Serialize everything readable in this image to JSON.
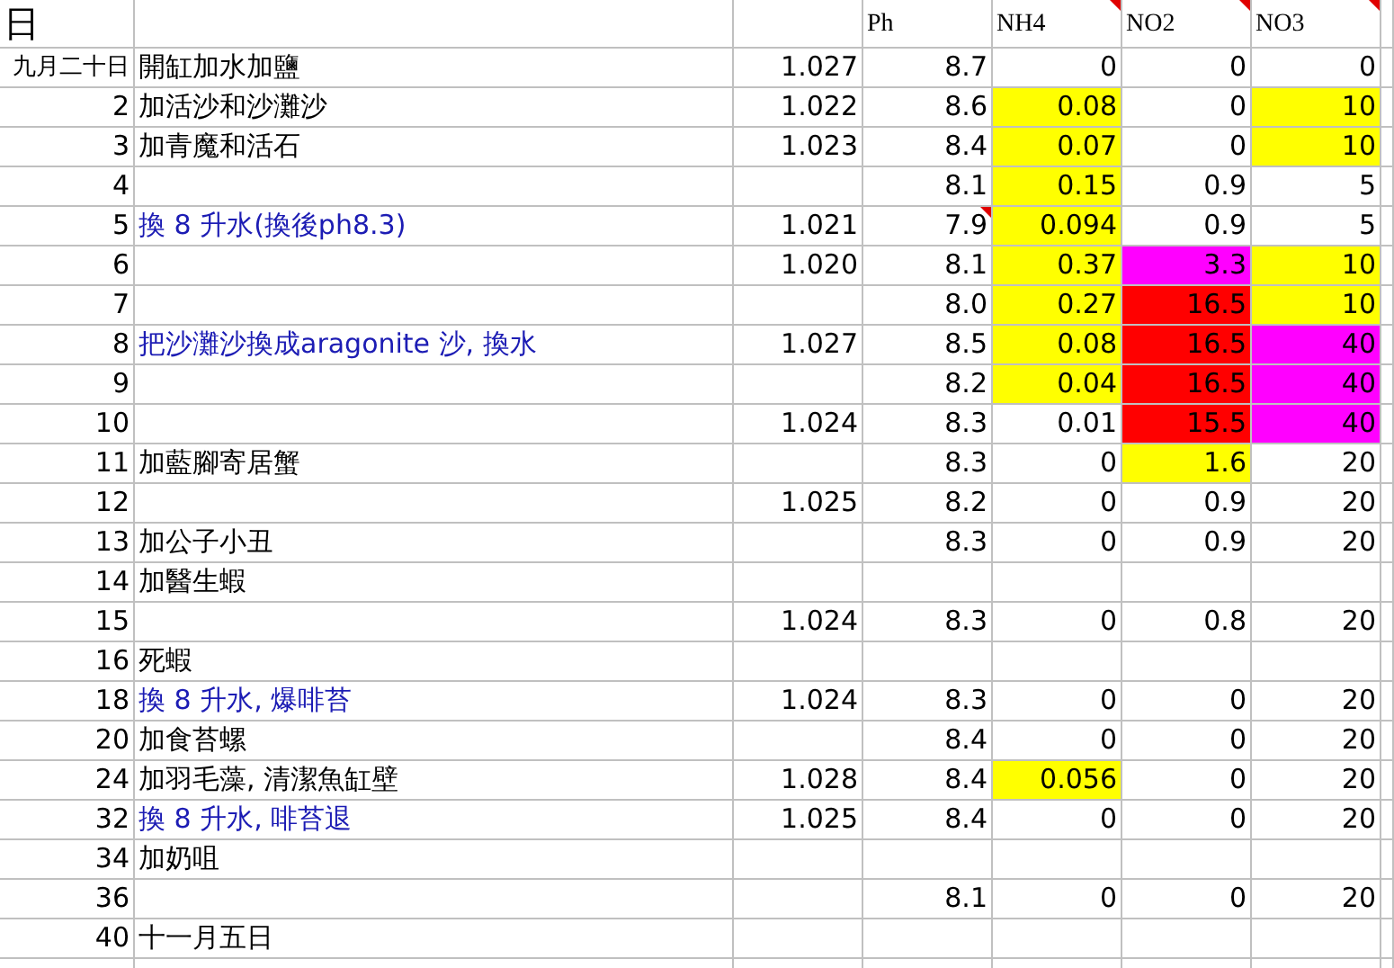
{
  "header": {
    "day": "日",
    "ph": "Ph",
    "nh4": {
      "text": "NH4",
      "comment": true
    },
    "no2": {
      "text": "NO2",
      "comment": true
    },
    "no3": {
      "text": "NO3",
      "comment": true
    }
  },
  "rows": [
    {
      "day": "九月二十日",
      "note": "開缸加水加鹽",
      "sal": "1.027",
      "ph": "8.7",
      "nh4": "0",
      "no2": "0",
      "no3": "0"
    },
    {
      "day": "2",
      "note": "加活沙和沙灘沙",
      "sal": "1.022",
      "ph": "8.6",
      "nh4": {
        "text": "0.08",
        "color": "#ffff00"
      },
      "no2": "0",
      "no3": {
        "text": "10",
        "color": "#ffff00"
      }
    },
    {
      "day": "3",
      "note": "加青魔和活石",
      "sal": "1.023",
      "ph": "8.4",
      "nh4": {
        "text": "0.07",
        "color": "#ffff00"
      },
      "no2": "0",
      "no3": {
        "text": "10",
        "color": "#ffff00"
      }
    },
    {
      "day": "4",
      "ph": "8.1",
      "nh4": {
        "text": "0.15",
        "color": "#ffff00"
      },
      "no2": "0.9",
      "no3": "5"
    },
    {
      "day": "5",
      "note": {
        "text": "換 8 升水(換後ph8.3)",
        "color": "#1c1cb4"
      },
      "sal": "1.021",
      "ph": {
        "text": "7.9",
        "comment": true
      },
      "nh4": {
        "text": "0.094",
        "color": "#ffff00"
      },
      "no2": "0.9",
      "no3": "5"
    },
    {
      "day": "6",
      "sal": "1.020",
      "ph": "8.1",
      "nh4": {
        "text": "0.37",
        "color": "#ffff00"
      },
      "no2": {
        "text": "3.3",
        "color": "#ff00ff"
      },
      "no3": {
        "text": "10",
        "color": "#ffff00"
      }
    },
    {
      "day": "7",
      "ph": "8.0",
      "nh4": {
        "text": "0.27",
        "color": "#ffff00"
      },
      "no2": {
        "text": "16.5",
        "color": "#ff0000"
      },
      "no3": {
        "text": "10",
        "color": "#ffff00"
      }
    },
    {
      "day": "8",
      "note": {
        "text": "把沙灘沙換成aragonite 沙, 換水",
        "color": "#1c1cb4"
      },
      "sal": "1.027",
      "ph": "8.5",
      "nh4": {
        "text": "0.08",
        "color": "#ffff00"
      },
      "no2": {
        "text": "16.5",
        "color": "#ff0000"
      },
      "no3": {
        "text": "40",
        "color": "#ff00ff"
      }
    },
    {
      "day": "9",
      "ph": "8.2",
      "nh4": {
        "text": "0.04",
        "color": "#ffff00"
      },
      "no2": {
        "text": "16.5",
        "color": "#ff0000"
      },
      "no3": {
        "text": "40",
        "color": "#ff00ff"
      }
    },
    {
      "day": "10",
      "sal": "1.024",
      "ph": "8.3",
      "nh4": "0.01",
      "no2": {
        "text": "15.5",
        "color": "#ff0000"
      },
      "no3": {
        "text": "40",
        "color": "#ff00ff"
      }
    },
    {
      "day": "11",
      "note": "加藍腳寄居蟹",
      "ph": "8.3",
      "nh4": "0",
      "no2": {
        "text": "1.6",
        "color": "#ffff00"
      },
      "no3": "20"
    },
    {
      "day": "12",
      "sal": "1.025",
      "ph": "8.2",
      "nh4": "0",
      "no2": "0.9",
      "no3": "20"
    },
    {
      "day": "13",
      "note": "加公子小丑",
      "ph": "8.3",
      "nh4": "0",
      "no2": "0.9",
      "no3": "20"
    },
    {
      "day": "14",
      "note": "加醫生蝦"
    },
    {
      "day": "15",
      "sal": "1.024",
      "ph": "8.3",
      "nh4": "0",
      "no2": "0.8",
      "no3": "20"
    },
    {
      "day": "16",
      "note": "死蝦"
    },
    {
      "day": "18",
      "note": {
        "text": "換 8 升水, 爆啡苔",
        "color": "#1c1cb4"
      },
      "sal": "1.024",
      "ph": "8.3",
      "nh4": "0",
      "no2": "0",
      "no3": "20"
    },
    {
      "day": "20",
      "note": "加食苔螺",
      "ph": "8.4",
      "nh4": "0",
      "no2": "0",
      "no3": "20"
    },
    {
      "day": "24",
      "note": "加羽毛藻, 清潔魚缸壁",
      "sal": "1.028",
      "ph": "8.4",
      "nh4": {
        "text": "0.056",
        "color": "#ffff00"
      },
      "no2": "0",
      "no3": "20"
    },
    {
      "day": "32",
      "note": {
        "text": "換 8 升水, 啡苔退",
        "color": "#1c1cb4"
      },
      "sal": "1.025",
      "ph": "8.4",
      "nh4": "0",
      "no2": "0",
      "no3": "20"
    },
    {
      "day": "34",
      "note": "加奶咀"
    },
    {
      "day": "36",
      "ph": "8.1",
      "nh4": "0",
      "no2": "0",
      "no3": "20"
    },
    {
      "day": "40",
      "note": "十一月五日"
    },
    {}
  ]
}
